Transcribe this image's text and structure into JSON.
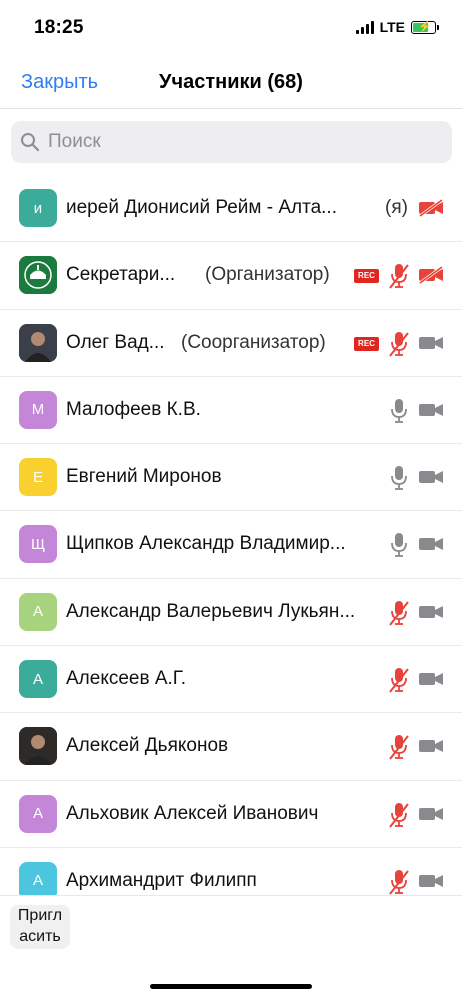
{
  "status_bar": {
    "time": "18:25",
    "network": "LTE"
  },
  "nav": {
    "close_label": "Закрыть",
    "title": "Участники (68)"
  },
  "search": {
    "placeholder": "Поиск"
  },
  "participants": [
    {
      "name": "иерей Дионисий Рейм - Алта...",
      "role": "(я)",
      "avatar_letter": "и",
      "avatar_color": "#3bab9a",
      "avatar_type": "letter",
      "rec": false,
      "mic": "none",
      "video": "off"
    },
    {
      "name": "Секретари...",
      "role": "(Организатор)",
      "avatar_letter": "",
      "avatar_color": "#1b7a3e",
      "avatar_type": "logo",
      "rec": true,
      "rec_label": "REC",
      "mic": "muted",
      "video": "off"
    },
    {
      "name": "Олег Вад...",
      "role": "(Соорганизатор)",
      "avatar_letter": "",
      "avatar_color": "#3a3f4a",
      "avatar_type": "photo",
      "rec": true,
      "rec_label": "REC",
      "mic": "muted",
      "video": "on"
    },
    {
      "name": "Малофеев К.В.",
      "role": "",
      "avatar_letter": "М",
      "avatar_color": "#c386d9",
      "avatar_type": "letter",
      "rec": false,
      "mic": "on",
      "video": "on"
    },
    {
      "name": "Евгений Миронов",
      "role": "",
      "avatar_letter": "Е",
      "avatar_color": "#f8d12f",
      "avatar_type": "letter",
      "rec": false,
      "mic": "on",
      "video": "on"
    },
    {
      "name": "Щипков Александр Владимир...",
      "role": "",
      "avatar_letter": "Щ",
      "avatar_color": "#c386d9",
      "avatar_type": "letter",
      "rec": false,
      "mic": "on",
      "video": "on"
    },
    {
      "name": "Александр Валерьевич Лукьян...",
      "role": "",
      "avatar_letter": "А",
      "avatar_color": "#a8d37e",
      "avatar_type": "letter",
      "rec": false,
      "mic": "muted",
      "video": "on"
    },
    {
      "name": "Алексеев  А.Г.",
      "role": "",
      "avatar_letter": "А",
      "avatar_color": "#3bab9a",
      "avatar_type": "letter",
      "rec": false,
      "mic": "muted",
      "video": "on"
    },
    {
      "name": "Алексей Дьяконов",
      "role": "",
      "avatar_letter": "",
      "avatar_color": "#2e2a28",
      "avatar_type": "photo",
      "rec": false,
      "mic": "muted",
      "video": "on"
    },
    {
      "name": "Альховик  Алексей Иванович",
      "role": "",
      "avatar_letter": "А",
      "avatar_color": "#c386d9",
      "avatar_type": "letter",
      "rec": false,
      "mic": "muted",
      "video": "on"
    },
    {
      "name": "Архимандрит Филипп",
      "role": "",
      "avatar_letter": "А",
      "avatar_color": "#4cc6df",
      "avatar_type": "letter",
      "rec": false,
      "mic": "muted",
      "video": "on"
    }
  ],
  "bottom": {
    "invite_line1": "Пригл",
    "invite_line2": "асить"
  },
  "colors": {
    "accent": "#2f7ff0",
    "muted_red": "#e8433a",
    "icon_gray": "#8a8a8e",
    "rec_red": "#e0261f"
  }
}
